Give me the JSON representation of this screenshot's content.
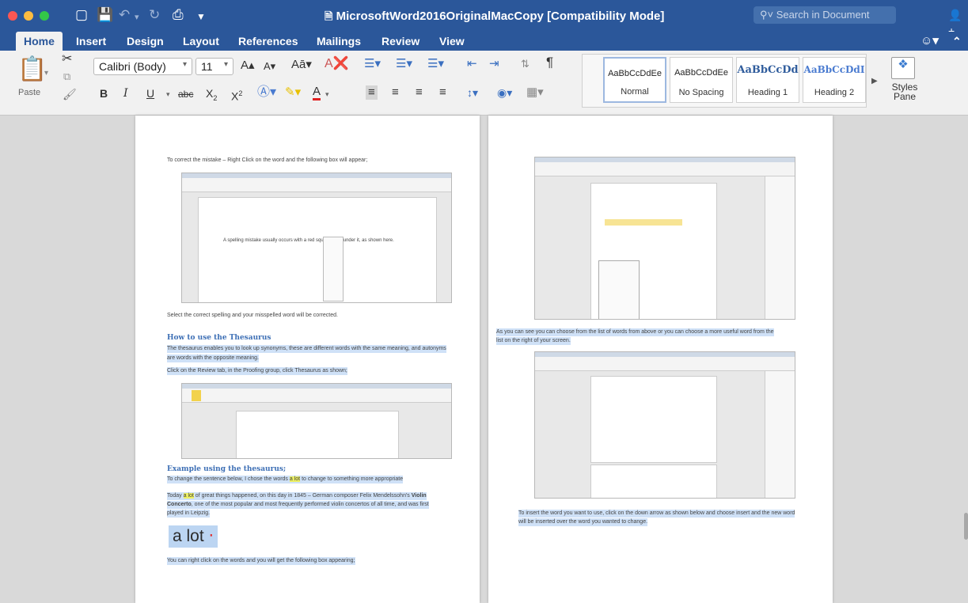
{
  "window": {
    "title": "MicrosoftWord2016OriginalMacCopy [Compatibility Mode]",
    "search_placeholder": "Search in Document",
    "traffic_colors": [
      "#fc5753",
      "#fdbc40",
      "#33c748"
    ]
  },
  "tabs": [
    "Home",
    "Insert",
    "Design",
    "Layout",
    "References",
    "Mailings",
    "Review",
    "View"
  ],
  "active_tab": "Home",
  "ribbon": {
    "paste_label": "Paste",
    "font_name": "Calibri (Body)",
    "font_size": "11",
    "styles": [
      {
        "sample": "AaBbCcDdEe",
        "name": "Normal"
      },
      {
        "sample": "AaBbCcDdEe",
        "name": "No Spacing"
      },
      {
        "sample": "AaBbCcDd",
        "name": "Heading 1"
      },
      {
        "sample": "AaBbCcDdI",
        "name": "Heading 2"
      }
    ],
    "styles_pane_label": "Styles Pane"
  },
  "page1": {
    "intro": "To correct the mistake – Right Click on the word and the following box will appear;",
    "shot1_caption": "A spelling mistake usually occurs with a red squiggly line under it, as shown here.",
    "after_shot1": "Select the correct spelling and your misspelled word will be corrected.",
    "heading1": "How to use the Thesaurus",
    "para1a": "The thesaurus enables you to look up synonyms, these are different words with the same meaning, and autonyms",
    "para1b": "are words with the opposite meaning.",
    "para2": "Click on the Review tab, in the Proofing group, click Thesaurus as shown;",
    "heading2": "Example using the thesaurus;",
    "para3_pre": "To change the sentence below, I chose the words ",
    "para3_hl": "a lot",
    "para3_post": " to change to something more appropriate",
    "para4_pre": "Today ",
    "para4_hl": "a lot",
    "para4_mid": " of great things happened, on this day in 1845 – German composer Felix Mendelssohn's ",
    "para4_bold": "Violin",
    "para4b_bold": "Concerto",
    "para4b": ", one of the most popular and most frequently performed violin concertos of all time, and was first",
    "para4c": "played in Leipzig.",
    "big_text": "a lot",
    "para5": "You can right click on the words and you will get the following box appearing;"
  },
  "page2": {
    "para1a": "As you can see you can choose from the list of words from above or you can choose a more useful word from the",
    "para1b": "list on the right of your screen.",
    "para2a": "To insert the word you want to use, click on the down arrow as shown below and choose insert and the new word",
    "para2b": "will be inserted over the word you wanted to change."
  },
  "colors": {
    "brand": "#2b579a",
    "highlight": "#cfe1f7",
    "word_highlight": "#ecef63",
    "heading": "#3d6fb5"
  }
}
